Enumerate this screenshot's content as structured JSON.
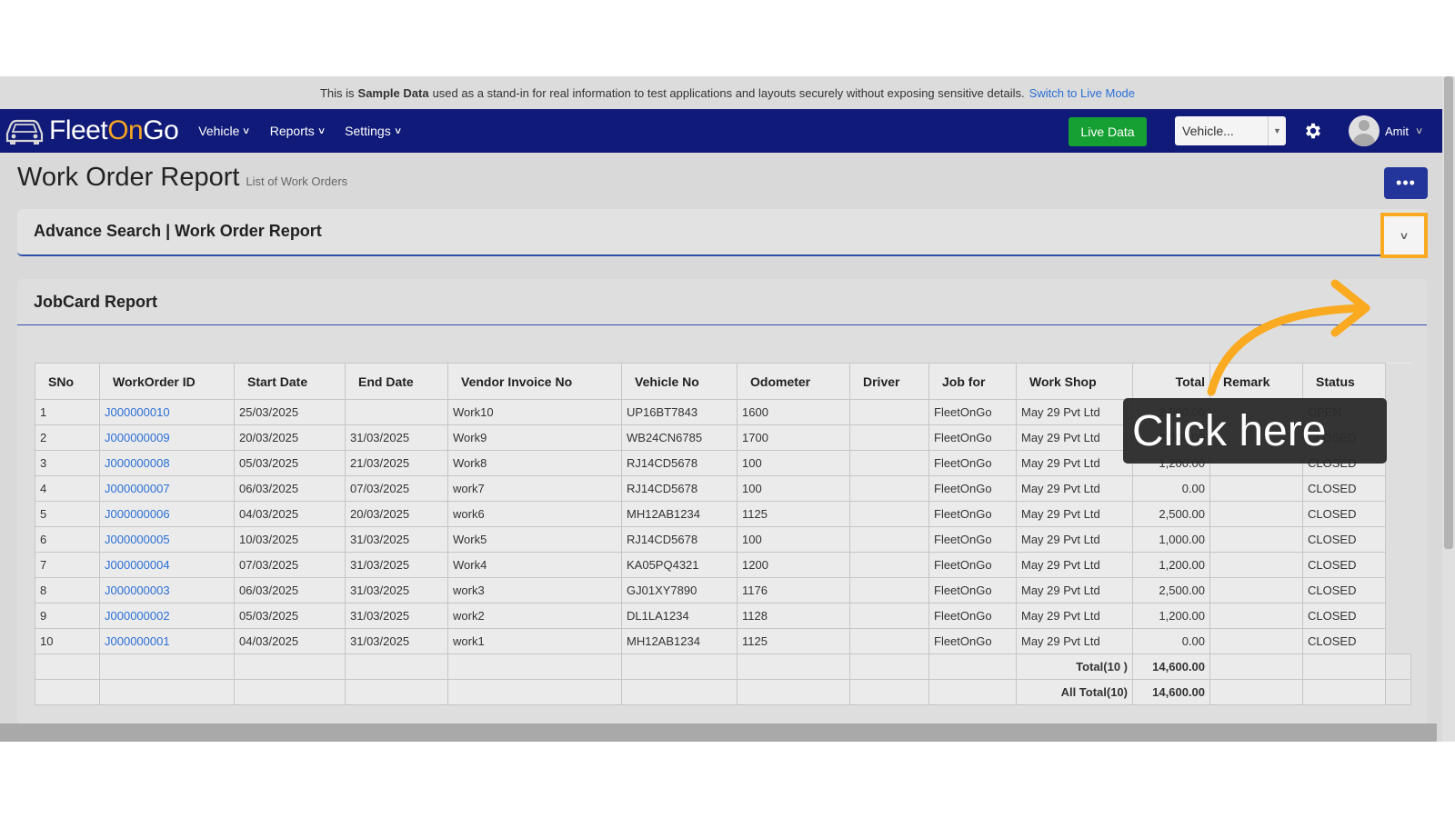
{
  "notice": {
    "prefix": "This is",
    "bold": "Sample Data",
    "rest": "used as a stand-in for real information to test applications and layouts securely without exposing sensitive details.",
    "link": "Switch to Live Mode"
  },
  "nav": {
    "logo_fleet": "Fleet",
    "logo_on": "On",
    "logo_go": "Go",
    "menu": [
      "Vehicle",
      "Reports",
      "Settings"
    ],
    "live_data": "Live Data",
    "vehicle_select": "Vehicle...",
    "user_name": "Amit"
  },
  "header": {
    "title": "Work Order Report",
    "subtitle": "List of Work Orders",
    "more_label": "•••"
  },
  "advance_search": {
    "title": "Advance Search | Work Order Report"
  },
  "jobcard": {
    "title": "JobCard Report",
    "columns": [
      "SNo",
      "WorkOrder ID",
      "Start Date",
      "End Date",
      "Vendor Invoice No",
      "Vehicle No",
      "Odometer",
      "Driver",
      "Job for",
      "Work Shop",
      "Total",
      "Remark",
      "Status"
    ],
    "rows": [
      [
        "1",
        "J000000010",
        "25/03/2025",
        "",
        "Work10",
        "UP16BT7843",
        "1600",
        "",
        "FleetOnGo",
        "May 29 Pvt Ltd",
        "2,500.00",
        "",
        "OPEN"
      ],
      [
        "2",
        "J000000009",
        "20/03/2025",
        "31/03/2025",
        "Work9",
        "WB24CN6785",
        "1700",
        "",
        "FleetOnGo",
        "May 29 Pvt Ltd",
        "2,500.00",
        "",
        "CLOSED"
      ],
      [
        "3",
        "J000000008",
        "05/03/2025",
        "21/03/2025",
        "Work8",
        "RJ14CD5678",
        "100",
        "",
        "FleetOnGo",
        "May 29 Pvt Ltd",
        "1,200.00",
        "",
        "CLOSED"
      ],
      [
        "4",
        "J000000007",
        "06/03/2025",
        "07/03/2025",
        "work7",
        "RJ14CD5678",
        "100",
        "",
        "FleetOnGo",
        "May 29 Pvt Ltd",
        "0.00",
        "",
        "CLOSED"
      ],
      [
        "5",
        "J000000006",
        "04/03/2025",
        "20/03/2025",
        "work6",
        "MH12AB1234",
        "1125",
        "",
        "FleetOnGo",
        "May 29 Pvt Ltd",
        "2,500.00",
        "",
        "CLOSED"
      ],
      [
        "6",
        "J000000005",
        "10/03/2025",
        "31/03/2025",
        "Work5",
        "RJ14CD5678",
        "100",
        "",
        "FleetOnGo",
        "May 29 Pvt Ltd",
        "1,000.00",
        "",
        "CLOSED"
      ],
      [
        "7",
        "J000000004",
        "07/03/2025",
        "31/03/2025",
        "Work4",
        "KA05PQ4321",
        "1200",
        "",
        "FleetOnGo",
        "May 29 Pvt Ltd",
        "1,200.00",
        "",
        "CLOSED"
      ],
      [
        "8",
        "J000000003",
        "06/03/2025",
        "31/03/2025",
        "work3",
        "GJ01XY7890",
        "1176",
        "",
        "FleetOnGo",
        "May 29 Pvt Ltd",
        "2,500.00",
        "",
        "CLOSED"
      ],
      [
        "9",
        "J000000002",
        "05/03/2025",
        "31/03/2025",
        "work2",
        "DL1LA1234",
        "1128",
        "",
        "FleetOnGo",
        "May 29 Pvt Ltd",
        "1,200.00",
        "",
        "CLOSED"
      ],
      [
        "10",
        "J000000001",
        "04/03/2025",
        "31/03/2025",
        "work1",
        "MH12AB1234",
        "1125",
        "",
        "FleetOnGo",
        "May 29 Pvt Ltd",
        "0.00",
        "",
        "CLOSED"
      ]
    ],
    "total_label": "Total(10 )",
    "total_value": "14,600.00",
    "all_total_label": "All Total(10)",
    "all_total_value": "14,600.00"
  },
  "callout": {
    "text": "Click here"
  },
  "colors": {
    "navbar": "#101a78",
    "accent": "#f9aa21",
    "live": "#16a033",
    "link": "#2a6fd6"
  }
}
